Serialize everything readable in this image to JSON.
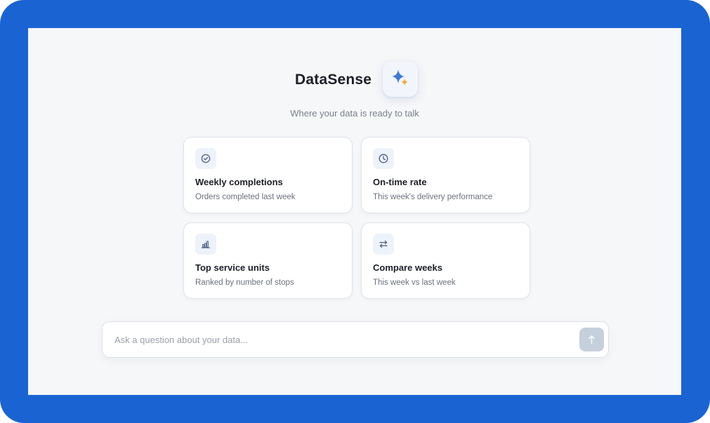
{
  "app": {
    "title": "DataSense",
    "tagline": "Where your data is ready to talk",
    "logo_icon": "sparkle-icon",
    "accent_color": "#1a63d3",
    "sparkle_colors": [
      "#3b7bd6",
      "#f2a83a"
    ]
  },
  "cards": [
    {
      "icon": "check-circle-icon",
      "title": "Weekly completions",
      "description": "Orders completed last week"
    },
    {
      "icon": "clock-icon",
      "title": "On-time rate",
      "description": "This week's delivery performance"
    },
    {
      "icon": "bar-chart-icon",
      "title": "Top service units",
      "description": "Ranked by number of stops"
    },
    {
      "icon": "swap-arrows-icon",
      "title": "Compare weeks",
      "description": "This week vs last week"
    }
  ],
  "ask": {
    "placeholder": "Ask a question about your data...",
    "value": "",
    "send_icon": "arrow-up-icon"
  }
}
